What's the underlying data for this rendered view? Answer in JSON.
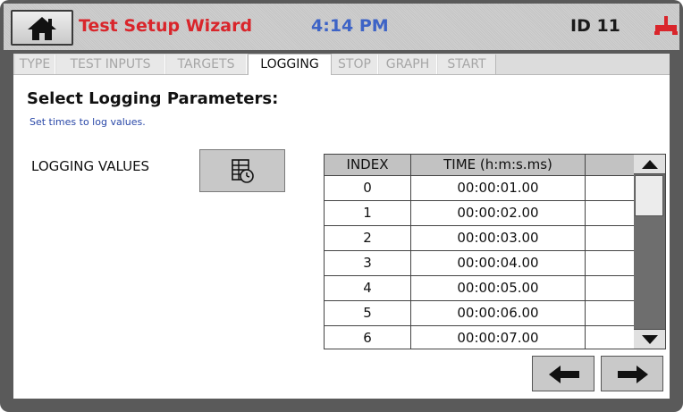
{
  "header": {
    "title": "Test Setup Wizard",
    "time": "4:14 PM",
    "id": "ID 11",
    "home_icon": "home-icon",
    "device_icon": "device-icon"
  },
  "tabs": [
    {
      "label": "TYPE",
      "active": false
    },
    {
      "label": "TEST INPUTS",
      "active": false
    },
    {
      "label": "TARGETS",
      "active": false
    },
    {
      "label": "LOGGING",
      "active": true
    },
    {
      "label": "STOP",
      "active": false
    },
    {
      "label": "GRAPH",
      "active": false
    },
    {
      "label": "START",
      "active": false
    }
  ],
  "section": {
    "title": "Select Logging Parameters:",
    "subtitle": "Set times to log values."
  },
  "logging": {
    "label": "LOGGING VALUES",
    "button_icon": "schedule-clock-icon"
  },
  "table": {
    "columns": [
      "INDEX",
      "TIME (h:m:s.ms)"
    ],
    "rows": [
      [
        "0",
        "00:00:01.00"
      ],
      [
        "1",
        "00:00:02.00"
      ],
      [
        "2",
        "00:00:03.00"
      ],
      [
        "3",
        "00:00:04.00"
      ],
      [
        "4",
        "00:00:05.00"
      ],
      [
        "5",
        "00:00:06.00"
      ],
      [
        "6",
        "00:00:07.00"
      ]
    ]
  },
  "navigation": {
    "prev_icon": "arrow-left-icon",
    "next_icon": "arrow-right-icon"
  },
  "colors": {
    "title_red": "#d9252b",
    "clock_blue": "#3d63c6",
    "subtitle_blue": "#2a48a8",
    "frame_gray": "#5a5a5a"
  }
}
